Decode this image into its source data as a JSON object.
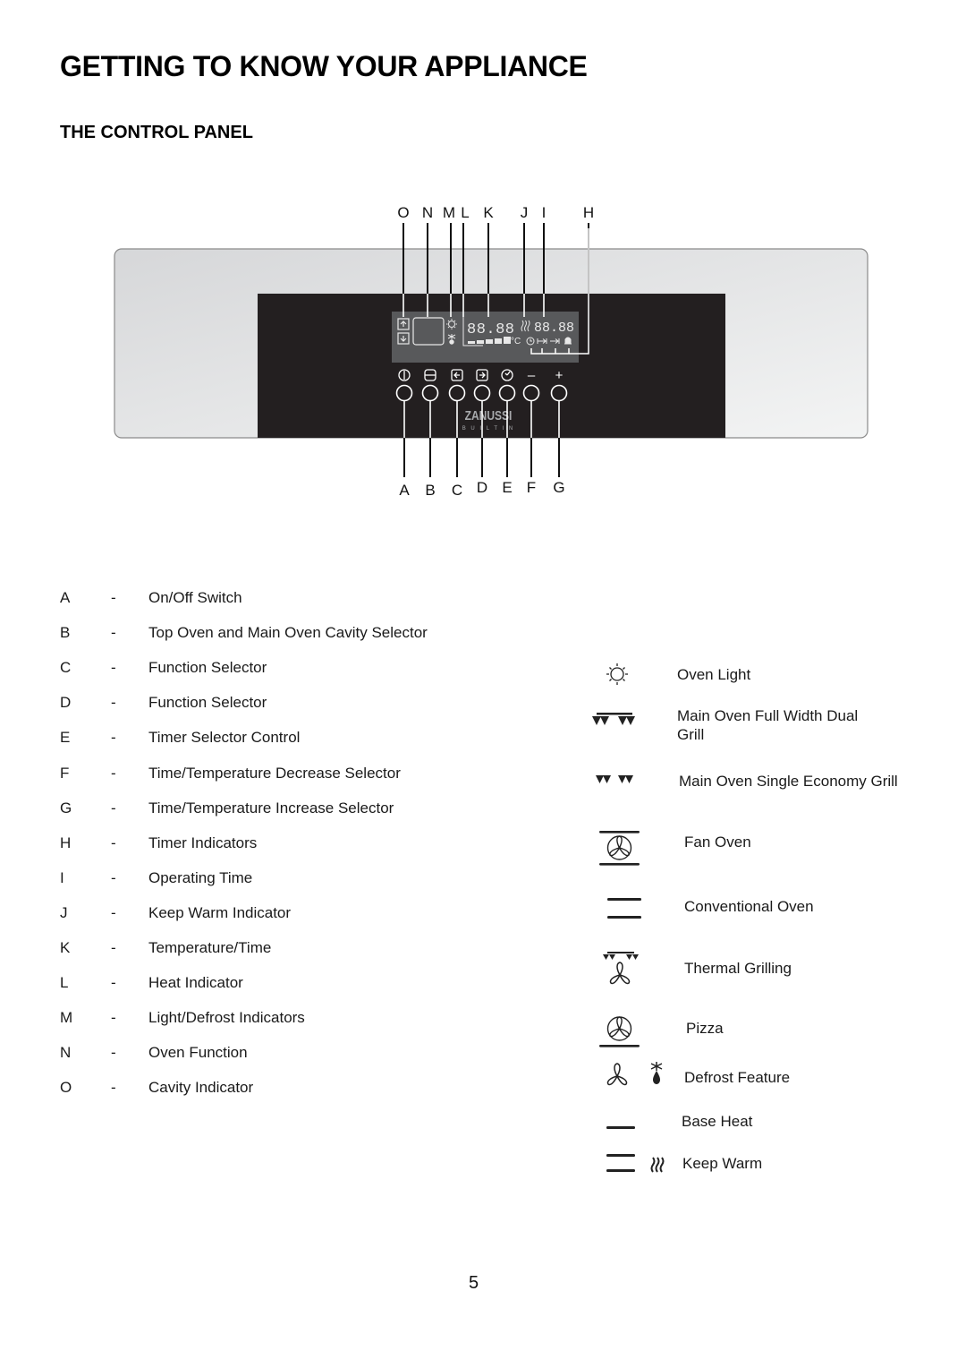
{
  "page": {
    "title": "GETTING TO KNOW YOUR APPLIANCE",
    "section_title": "THE CONTROL PANEL",
    "page_number": "5"
  },
  "diagram": {
    "top_callouts": [
      "O",
      "N",
      "M",
      "L",
      "K",
      "J",
      "I",
      "H"
    ],
    "bottom_callouts": [
      "A",
      "B",
      "C",
      "D",
      "E",
      "F",
      "G"
    ],
    "display": {
      "temperature_time_readout": "88.88",
      "timer_readout": "88.88",
      "temperature_unit": "°C"
    },
    "button_icons": [
      "power-icon",
      "cavity-selector-icon",
      "function-left-icon",
      "function-right-icon",
      "timer-icon",
      "minus-icon",
      "plus-icon"
    ],
    "button_symbols": [
      "",
      "",
      "",
      "",
      "",
      "–",
      "+"
    ],
    "brand": "ZANUSSI",
    "brand_sub": "B U I L T  I N",
    "colors": {
      "panel_black": "#231f20",
      "display_grey": "#58595b",
      "fascia_grey": "#dcdddf"
    }
  },
  "legend": [
    {
      "letter": "A",
      "dash": "-",
      "desc": "On/Off Switch"
    },
    {
      "letter": "B",
      "dash": "-",
      "desc": "Top Oven and Main Oven Cavity Selector"
    },
    {
      "letter": "C",
      "dash": "-",
      "desc": "Function Selector"
    },
    {
      "letter": "D",
      "dash": "-",
      "desc": "Function Selector"
    },
    {
      "letter": "E",
      "dash": "-",
      "desc": "Timer Selector Control"
    },
    {
      "letter": "F",
      "dash": "-",
      "desc": "Time/Temperature Decrease Selector"
    },
    {
      "letter": "G",
      "dash": "-",
      "desc": "Time/Temperature Increase Selector"
    },
    {
      "letter": "H",
      "dash": "-",
      "desc": "Timer Indicators"
    },
    {
      "letter": "I",
      "dash": "-",
      "desc": "Operating Time"
    },
    {
      "letter": "J",
      "dash": "-",
      "desc": "Keep Warm Indicator"
    },
    {
      "letter": "K",
      "dash": "-",
      "desc": "Temperature/Time"
    },
    {
      "letter": "L",
      "dash": "-",
      "desc": "Heat Indicator"
    },
    {
      "letter": "M",
      "dash": "-",
      "desc": "Light/Defrost Indicators"
    },
    {
      "letter": "N",
      "dash": "-",
      "desc": "Oven Function"
    },
    {
      "letter": "O",
      "dash": "-",
      "desc": "Cavity Indicator"
    }
  ],
  "symbols": [
    {
      "icon": "oven-light-icon",
      "label": "Oven Light"
    },
    {
      "icon": "dual-grill-icon",
      "label": "Main Oven Full Width Dual\nGrill"
    },
    {
      "icon": "economy-grill-icon",
      "label": "Main Oven Single Economy Grill"
    },
    {
      "icon": "fan-oven-icon",
      "label": "Fan Oven"
    },
    {
      "icon": "conventional-oven-icon",
      "label": "Conventional Oven"
    },
    {
      "icon": "thermal-grilling-icon",
      "label": "Thermal Grilling"
    },
    {
      "icon": "pizza-icon",
      "label": "Pizza"
    },
    {
      "icon": "defrost-icon",
      "label": "Defrost Feature"
    },
    {
      "icon": "base-heat-icon",
      "label": "Base Heat"
    },
    {
      "icon": "keep-warm-icon",
      "label": "Keep Warm"
    }
  ]
}
